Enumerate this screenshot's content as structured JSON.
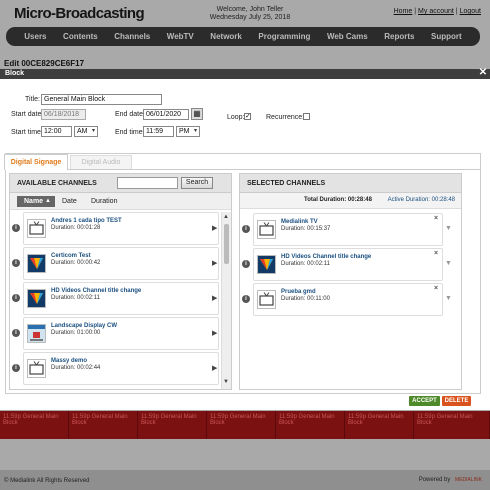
{
  "site": {
    "logo": "Micro-Broadcasting",
    "welcome_line1": "Welcome, John Teller",
    "welcome_line2": "Wednesday July 25, 2018",
    "links": {
      "home": "Home",
      "account": "My account",
      "logout": "Logout",
      "sep": "|"
    },
    "nav": [
      "Users",
      "Contents",
      "Channels",
      "WebTV",
      "Network",
      "Programming",
      "Web Cams",
      "Reports",
      "Support"
    ],
    "edit_title": "Edit 00CE829CE6F17",
    "schedule_cell_text": "11:59p General Main Block",
    "copyright": "© Medialink All Rights Reserved",
    "powered_by": "Powered by",
    "powered_logo": "MEDIALINK"
  },
  "modal": {
    "header": "Block",
    "close_glyph": "✕",
    "title_label": "Title:",
    "title_value": "General Main Block",
    "start_date_label": "Start date:",
    "start_date_value": "06/18/2018",
    "end_date_label": "End date:",
    "end_date_value": "06/01/2020",
    "start_time_label": "Start time:",
    "start_time_value": "12:00",
    "start_ampm": "AM",
    "end_time_label": "End time:",
    "end_time_value": "11:59",
    "end_ampm": "PM",
    "loop_label": "Loop:",
    "loop_checked": true,
    "recurrence_label": "Recurrence:",
    "recurrence_checked": false,
    "tabs": [
      {
        "label": "Digital Signage",
        "active": true
      },
      {
        "label": "Digital Audio",
        "active": false
      }
    ],
    "available": {
      "header": "AVAILABLE CHANNELS",
      "search_placeholder": "",
      "search_button": "Search",
      "sort": {
        "name": "Name",
        "date": "Date",
        "duration": "Duration"
      },
      "items": [
        {
          "title": "Andres 1 cada tipo TEST",
          "duration": "Duration: 00:01:28",
          "thumb": "tv-icon"
        },
        {
          "title": "Certicom Test",
          "duration": "Duration: 00:00:42",
          "thumb": "colorful-logo"
        },
        {
          "title": "HD Videos Channel title change",
          "duration": "Duration: 00:02:11",
          "thumb": "colorful-logo"
        },
        {
          "title": "Landscape Display CW",
          "duration": "Duration: 01:00:00",
          "thumb": "screenshot"
        },
        {
          "title": "Massy demo",
          "duration": "Duration: 00:02:44",
          "thumb": "tv-icon"
        }
      ]
    },
    "selected": {
      "header": "SELECTED CHANNELS",
      "total_label": "Total Duration: 00:28:48",
      "active_label": "Active Duration: 00:28:48",
      "items": [
        {
          "title": "Medialink TV",
          "duration": "Duration: 00:15:37",
          "thumb": "tv-icon"
        },
        {
          "title": "HD Videos Channel title change",
          "duration": "Duration: 00:02:11",
          "thumb": "colorful-logo"
        },
        {
          "title": "Prueba gmd",
          "duration": "Duration: 00:11:00",
          "thumb": "tv-icon"
        }
      ]
    },
    "accept_label": "ACCEPT",
    "delete_label": "DELETE"
  },
  "colors": {
    "accept": "#4e8a2a",
    "delete": "#d9531e",
    "active_tab": "#e07a1a",
    "link_text": "#1a4f80",
    "schedule_red": "#7b1111"
  }
}
